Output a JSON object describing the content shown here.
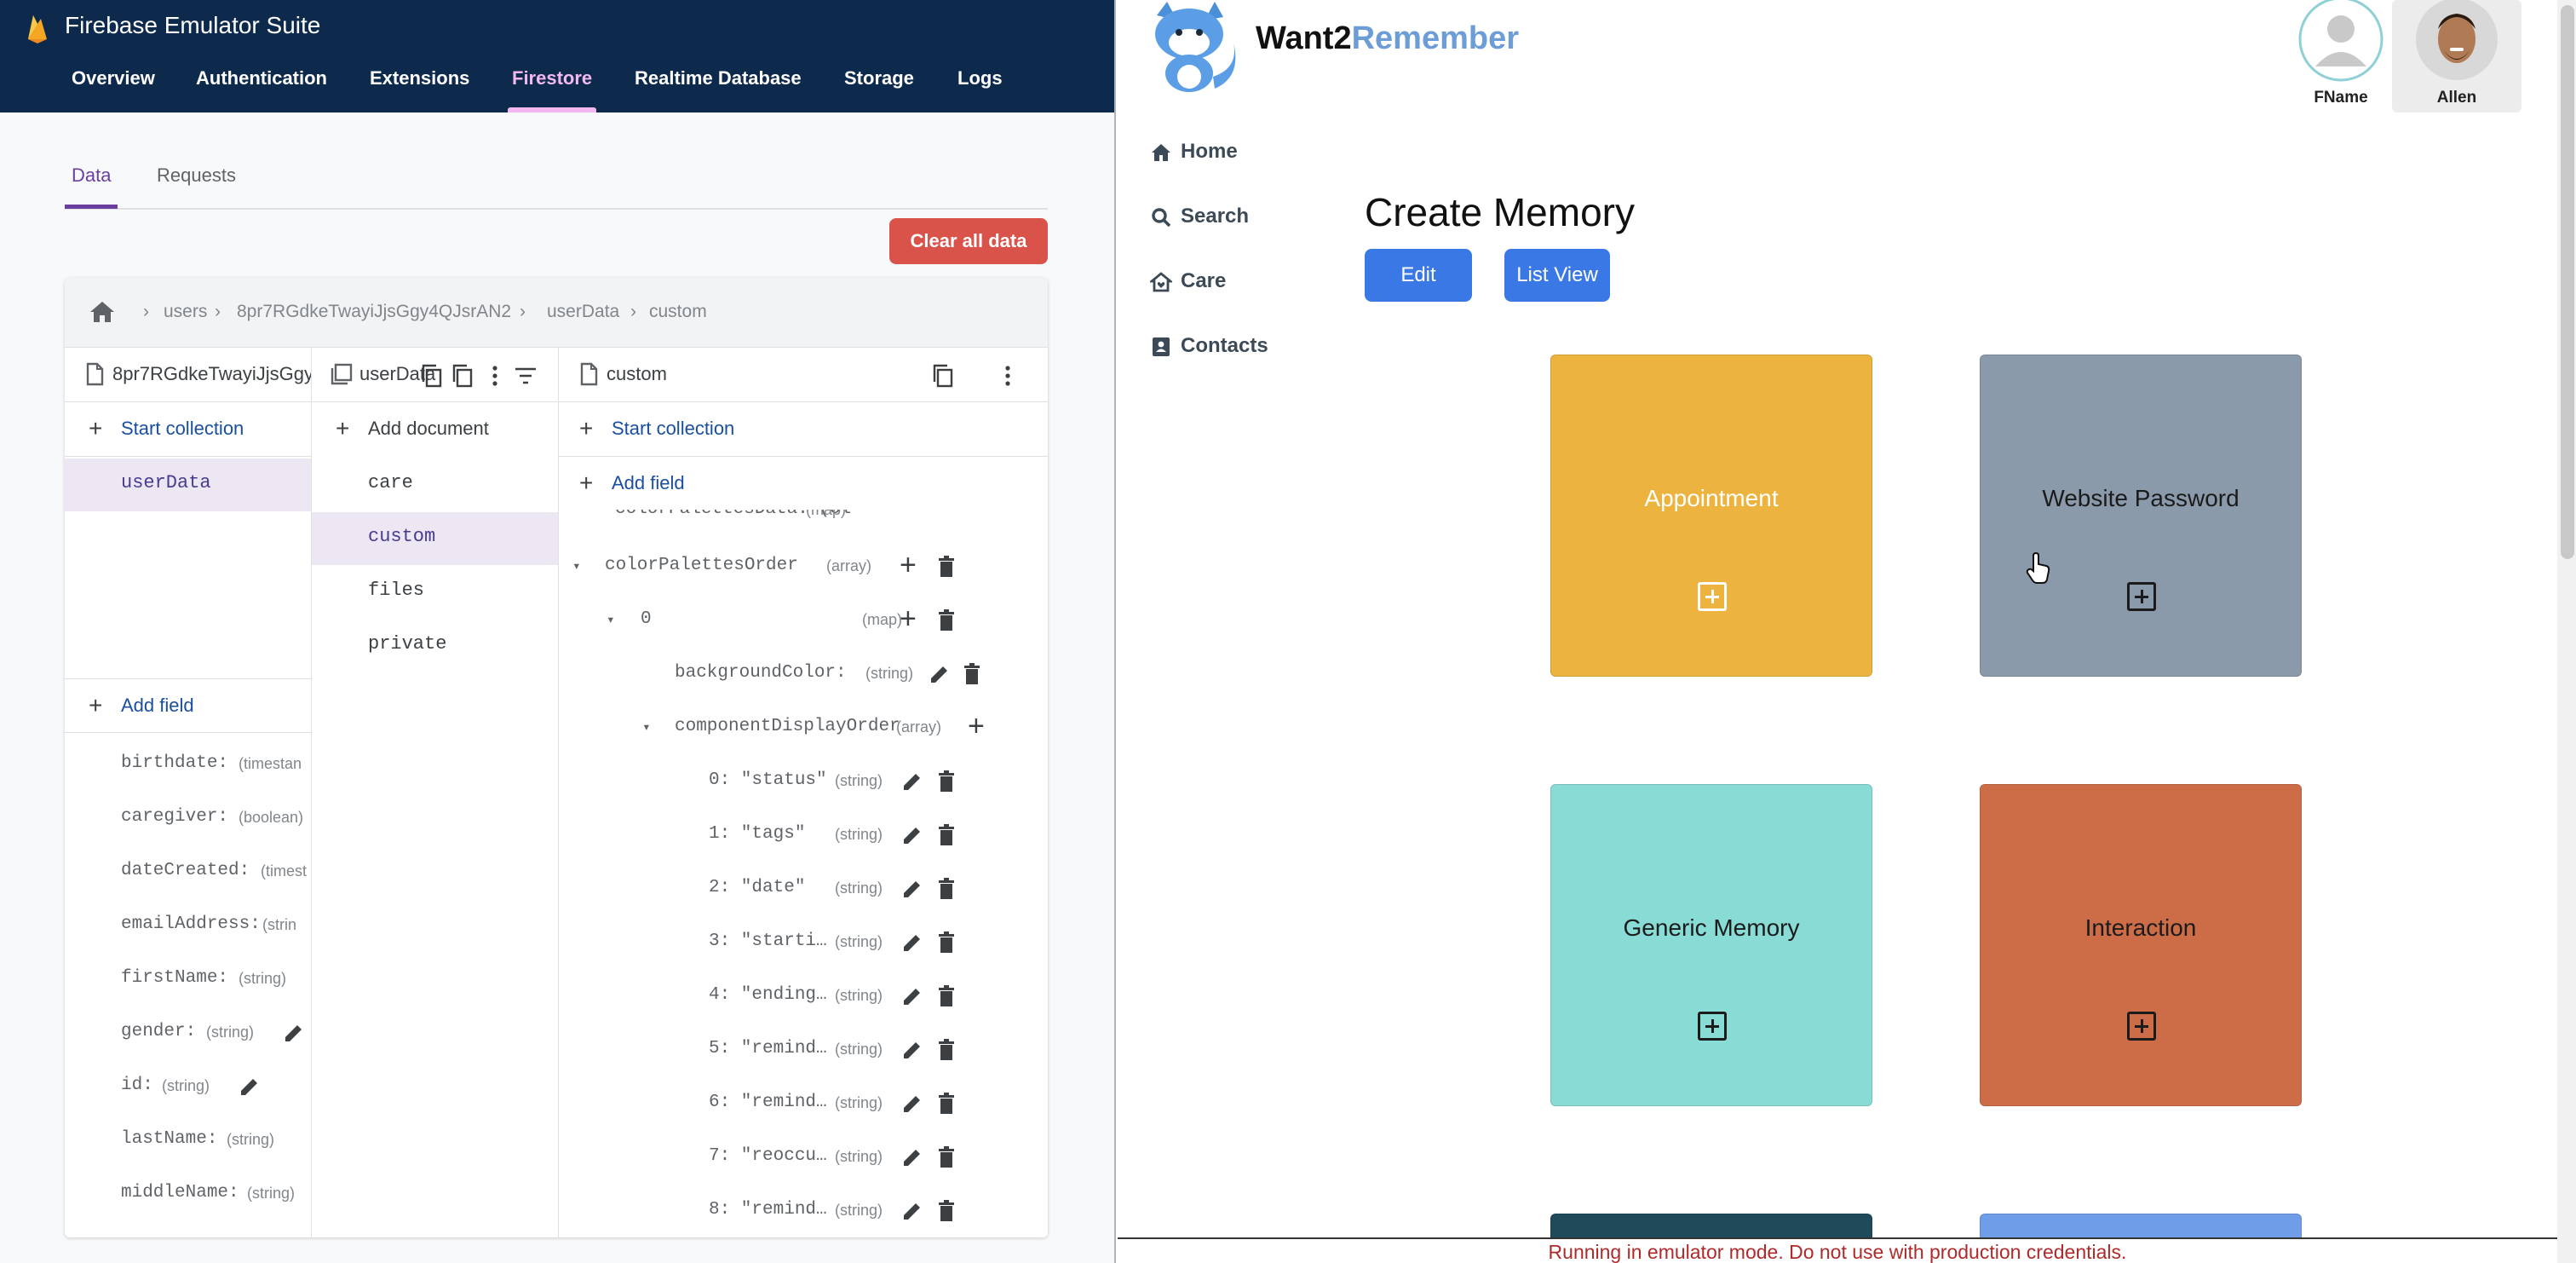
{
  "firebase": {
    "title": "Firebase Emulator Suite",
    "nav": [
      "Overview",
      "Authentication",
      "Extensions",
      "Firestore",
      "Realtime Database",
      "Storage",
      "Logs"
    ],
    "active_nav": "Firestore",
    "subtabs": [
      "Data",
      "Requests"
    ],
    "clear_label": "Clear all data",
    "breadcrumb": [
      "users",
      "8pr7RGdkeTwayiJjsGgy4QJsrAN2",
      "userData",
      "custom"
    ],
    "col1": {
      "title": "8pr7RGdkeTwayiJjsGgy",
      "start_collection": "Start collection",
      "items": [
        "userData"
      ],
      "add_field": "Add field",
      "fields": [
        {
          "key": "birthdate:",
          "type": "(timestan"
        },
        {
          "key": "caregiver:",
          "type": "(boolean)"
        },
        {
          "key": "dateCreated:",
          "type": "(timest"
        },
        {
          "key": "emailAddress:",
          "type": "(strin"
        },
        {
          "key": "firstName:",
          "type": "(string)"
        },
        {
          "key": "gender:",
          "type": "(string)"
        },
        {
          "key": "id:",
          "type": "(string)"
        },
        {
          "key": "lastName:",
          "type": "(string)"
        },
        {
          "key": "middleName:",
          "type": "(string)"
        }
      ]
    },
    "col2": {
      "title": "userData",
      "add_document": "Add document",
      "items": [
        "care",
        "custom",
        "files",
        "private"
      ]
    },
    "col3": {
      "title": "custom",
      "start_collection": "Start collection",
      "add_field": "Add field",
      "partial_row": "colorPalettesData: (ol",
      "partial_type": "(map)",
      "rows": [
        {
          "key": "colorPalettesOrder",
          "type": "(array)"
        },
        {
          "key": "0",
          "type": "(map)"
        },
        {
          "key": "backgroundColor:",
          "type": "(string)"
        },
        {
          "key": "componentDisplayOrder",
          "type": "(array)"
        },
        {
          "key": "0: \"status\"",
          "type": "(string)"
        },
        {
          "key": "1: \"tags\"",
          "type": "(string)"
        },
        {
          "key": "2: \"date\"",
          "type": "(string)"
        },
        {
          "key": "3: \"starti…",
          "type": "(string)"
        },
        {
          "key": "4: \"ending…",
          "type": "(string)"
        },
        {
          "key": "5: \"remind…",
          "type": "(string)"
        },
        {
          "key": "6: \"remind…",
          "type": "(string)"
        },
        {
          "key": "7: \"reoccu…",
          "type": "(string)"
        },
        {
          "key": "8: \"remind…",
          "type": "(string)"
        }
      ]
    }
  },
  "app": {
    "brand_1": "Want2",
    "brand_2": "Remember",
    "sidebar": [
      "Home",
      "Search",
      "Care",
      "Contacts"
    ],
    "page_title": "Create Memory",
    "buttons": {
      "edit": "Edit",
      "list_view": "List View"
    },
    "cards": [
      {
        "label": "Appointment",
        "color": "#ecb43e",
        "text_color": "#ffffff"
      },
      {
        "label": "Website Password",
        "color": "#8a9aab",
        "text_color": "#1b1b1b"
      },
      {
        "label": "Generic Memory",
        "color": "#89dbd5",
        "text_color": "#1b1b1b"
      },
      {
        "label": "Interaction",
        "color": "#cd6d48",
        "text_color": "#1b1b1b"
      }
    ],
    "partial_card_colors": [
      "#1f4a5a",
      "#6f9de8"
    ],
    "users": [
      "FName",
      "Allen"
    ],
    "banner": "Running in emulator mode. Do not use with production credentials."
  }
}
